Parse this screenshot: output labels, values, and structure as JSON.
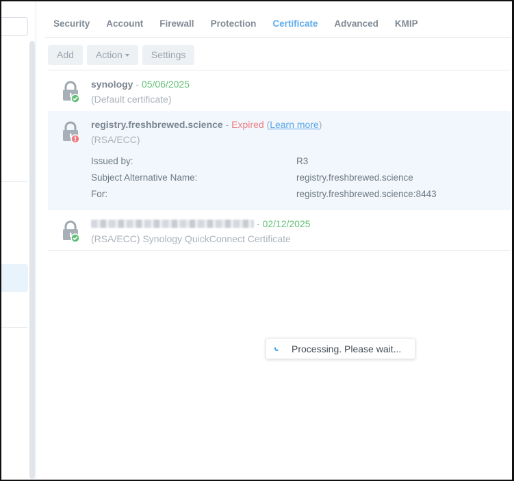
{
  "tabs": [
    {
      "label": "Security",
      "active": false
    },
    {
      "label": "Account",
      "active": false
    },
    {
      "label": "Firewall",
      "active": false
    },
    {
      "label": "Protection",
      "active": false
    },
    {
      "label": "Certificate",
      "active": true
    },
    {
      "label": "Advanced",
      "active": false
    },
    {
      "label": "KMIP",
      "active": false
    }
  ],
  "toolbar": {
    "add": "Add",
    "action": "Action",
    "settings": "Settings"
  },
  "certificates": [
    {
      "name": "synology",
      "separator": " - ",
      "date": "05/06/2025",
      "subtitle": "(Default certificate)",
      "status": "valid"
    },
    {
      "name": "registry.freshbrewed.science",
      "separator": " - ",
      "expired": "Expired",
      "learn_more": "Learn more",
      "subtitle": "(RSA/ECC)",
      "status": "error",
      "details": [
        {
          "label": "Issued by:",
          "value": "R3"
        },
        {
          "label": "Subject Alternative Name:",
          "value": "registry.freshbrewed.science"
        },
        {
          "label": "For:",
          "value": "registry.freshbrewed.science:8443"
        }
      ]
    },
    {
      "separator": " - ",
      "date": "02/12/2025",
      "subtitle": "(RSA/ECC) Synology QuickConnect Certificate",
      "status": "valid"
    }
  ],
  "toast": {
    "message": "Processing. Please wait..."
  },
  "colors": {
    "accent": "#5cacec",
    "valid": "#62c076",
    "error": "#ec7d82",
    "selected_bg": "#f1f7fd"
  },
  "icons": {
    "lock": "lock-icon",
    "valid_badge": "check-badge-icon",
    "error_badge": "alert-badge-icon",
    "spinner": "spinner-icon"
  }
}
